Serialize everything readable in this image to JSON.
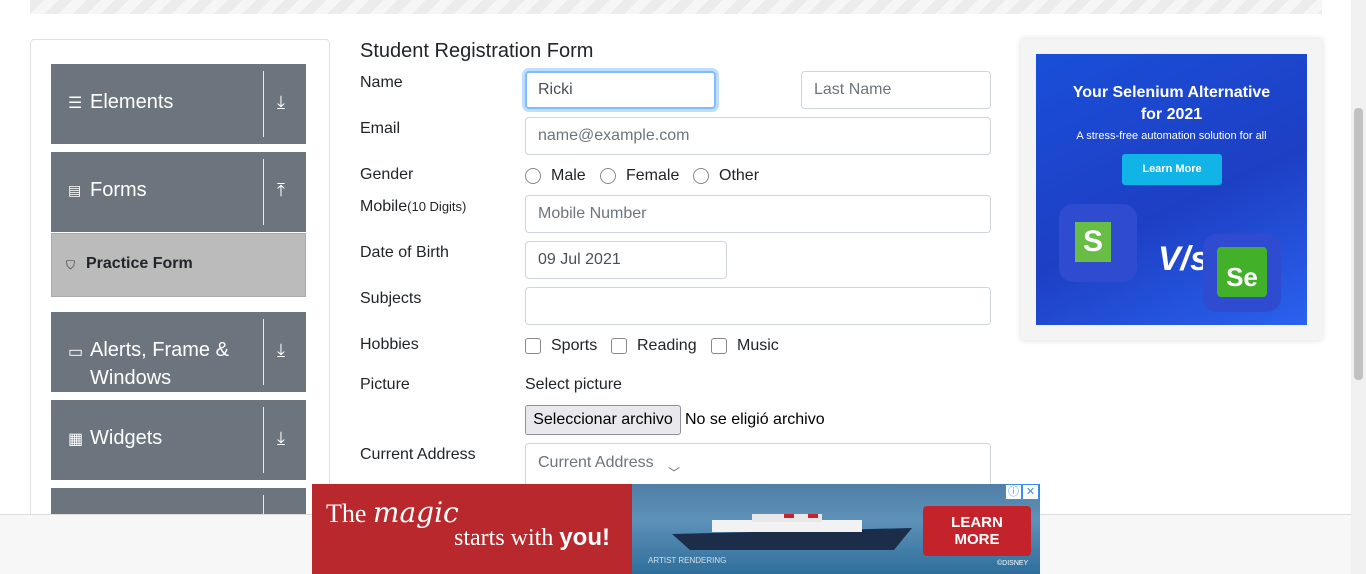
{
  "sidebar": {
    "groups": [
      {
        "label": "Elements",
        "icon": "hamburger-icon",
        "arrow": "download-arrow-icon"
      },
      {
        "label": "Forms",
        "icon": "document-icon",
        "arrow": "upload-arrow-icon"
      },
      {
        "label": "Alerts, Frame &",
        "label2": "Windows",
        "icon": "window-icon",
        "arrow": "download-arrow-icon"
      },
      {
        "label": "Widgets",
        "icon": "widgets-icon",
        "arrow": "download-arrow-icon"
      }
    ],
    "active_item": {
      "label": "Practice Form",
      "icon": "html5-icon"
    }
  },
  "form": {
    "title": "Student Registration Form",
    "name_label": "Name",
    "first_name_value": "Ricki",
    "last_name_placeholder": "Last Name",
    "email_label": "Email",
    "email_placeholder": "name@example.com",
    "gender_label": "Gender",
    "gender_options": [
      "Male",
      "Female",
      "Other"
    ],
    "mobile_label": "Mobile",
    "mobile_hint": "(10 Digits)",
    "mobile_placeholder": "Mobile Number",
    "dob_label": "Date of Birth",
    "dob_value": "09 Jul 2021",
    "subjects_label": "Subjects",
    "hobbies_label": "Hobbies",
    "hobbies_options": [
      "Sports",
      "Reading",
      "Music"
    ],
    "picture_label": "Picture",
    "select_picture": "Select picture",
    "file_button": "Seleccionar archivo",
    "file_status": "No se eligió archivo",
    "address_label": "Current Address",
    "address_placeholder": "Current Address"
  },
  "ad_right": {
    "headline1": "Your Selenium Alternative",
    "headline2": "for 2021",
    "subtext": "A stress-free automation solution for all",
    "button": "Learn More",
    "vs": "V/s",
    "logo_left": "S",
    "logo_right": "Se"
  },
  "ad_bottom": {
    "line1_a": "The",
    "line1_b": "magic",
    "line2_a": "starts with",
    "line2_b": "you!",
    "cta_line1": "LEARN",
    "cta_line2": "MORE",
    "caption": "ARTIST RENDERING",
    "brand": "©DISNEY",
    "info_icon": "ⓘ",
    "close_icon": "✕"
  },
  "colors": {
    "sidebar_group": "#6c757d",
    "active_item": "#bbbbbb",
    "focus_border": "#80bdff",
    "ad_blue": "#1d3fc4",
    "ad_red": "#b8282c"
  }
}
